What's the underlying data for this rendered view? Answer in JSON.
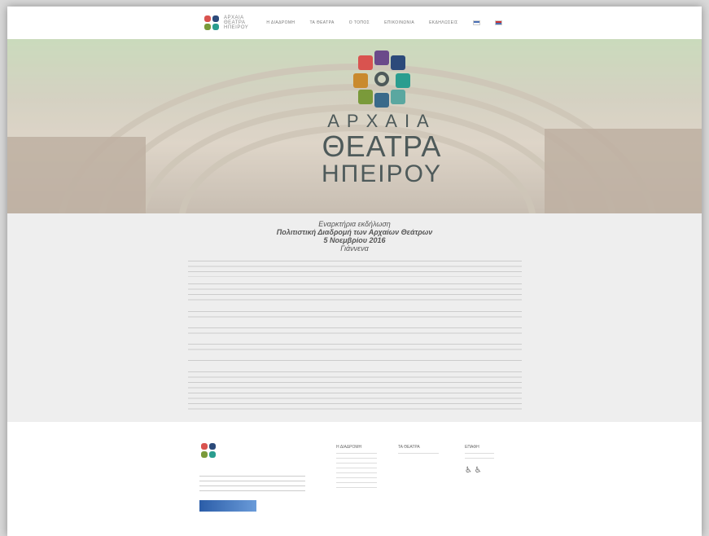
{
  "header": {
    "logo_lines": [
      "ΑΡΧΑΙΑ",
      "ΘΕΑΤΡΑ",
      "ΗΠΕΙΡΟΥ"
    ],
    "nav": [
      "Η ΔΙΑΔΡΟΜΗ",
      "ΤΑ ΘΕΑΤΡΑ",
      "Ο ΤΟΠΟΣ",
      "ΕΠΙΚΟΙΝΩΝΙΑ",
      "ΕΚΔΗΛΩΣΕΙΣ"
    ]
  },
  "hero": {
    "line1": "ΑΡΧΑΙΑ",
    "line2": "ΘΕΑΤΡΑ",
    "line3": "ΗΠΕΙΡΟΥ"
  },
  "announcement": {
    "line1": "Εναρκτήρια εκδήλωση",
    "line2": "Πολιτιστική Διαδρομή των Αρχαίων Θεάτρων",
    "line3": "5 Νοεμβρίου 2016",
    "line4": "Γιάννενα"
  },
  "colors": {
    "frame_bg": "#ffffff",
    "content_bg": "#eeeeee",
    "logo_text": "#4e5a5a",
    "petal_red": "#d9534f",
    "petal_blue": "#2c4a7a",
    "petal_teal": "#2a9d8f",
    "petal_green": "#7a9a3a"
  },
  "footer": {
    "col1_title": "Η ΔΙΑΔΡΟΜΗ",
    "col2_title": "ΤΑ ΘΕΑΤΡΑ",
    "col3_title": "ΕΠΑΦΗ"
  }
}
